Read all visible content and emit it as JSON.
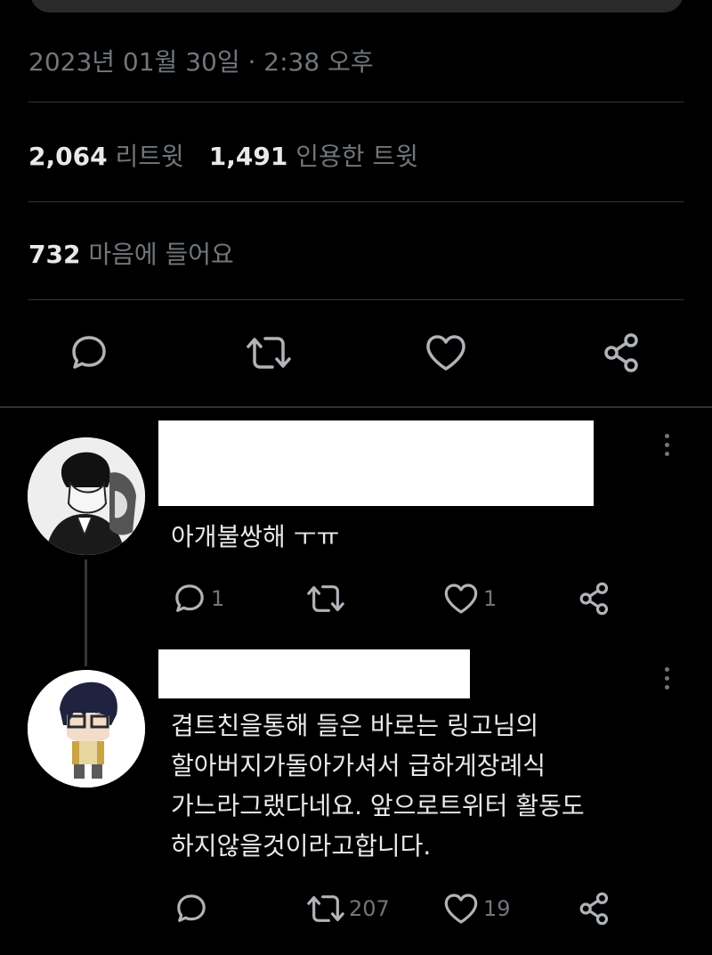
{
  "tweet": {
    "timestamp": "2023년 01월 30일 · 2:38 오후",
    "retweets_count": "2,064",
    "retweets_label": "리트윗",
    "quotes_count": "1,491",
    "quotes_label": "인용한 트윗",
    "likes_count": "732",
    "likes_label": "마음에 들어요"
  },
  "replies": [
    {
      "text": "아개불쌍해 ㅜㅠ",
      "reply_count": "1",
      "retweet_count": "",
      "like_count": "1"
    },
    {
      "text": "겹트친을통해 들은 바로는 링고님의\n할아버지가돌아가셔서 급하게장례식\n가느라그랬다네요. 앞으로트위터 활동도\n하지않을것이라고합니다.",
      "reply_count": "",
      "retweet_count": "207",
      "like_count": "19"
    }
  ],
  "icons": {
    "reply": "reply-icon",
    "retweet": "retweet-icon",
    "like": "heart-icon",
    "share": "share-icon",
    "more": "more-icon"
  },
  "colors": {
    "background": "#000000",
    "text": "#e7e9ea",
    "secondary": "#71767b",
    "divider": "#2f3336"
  }
}
